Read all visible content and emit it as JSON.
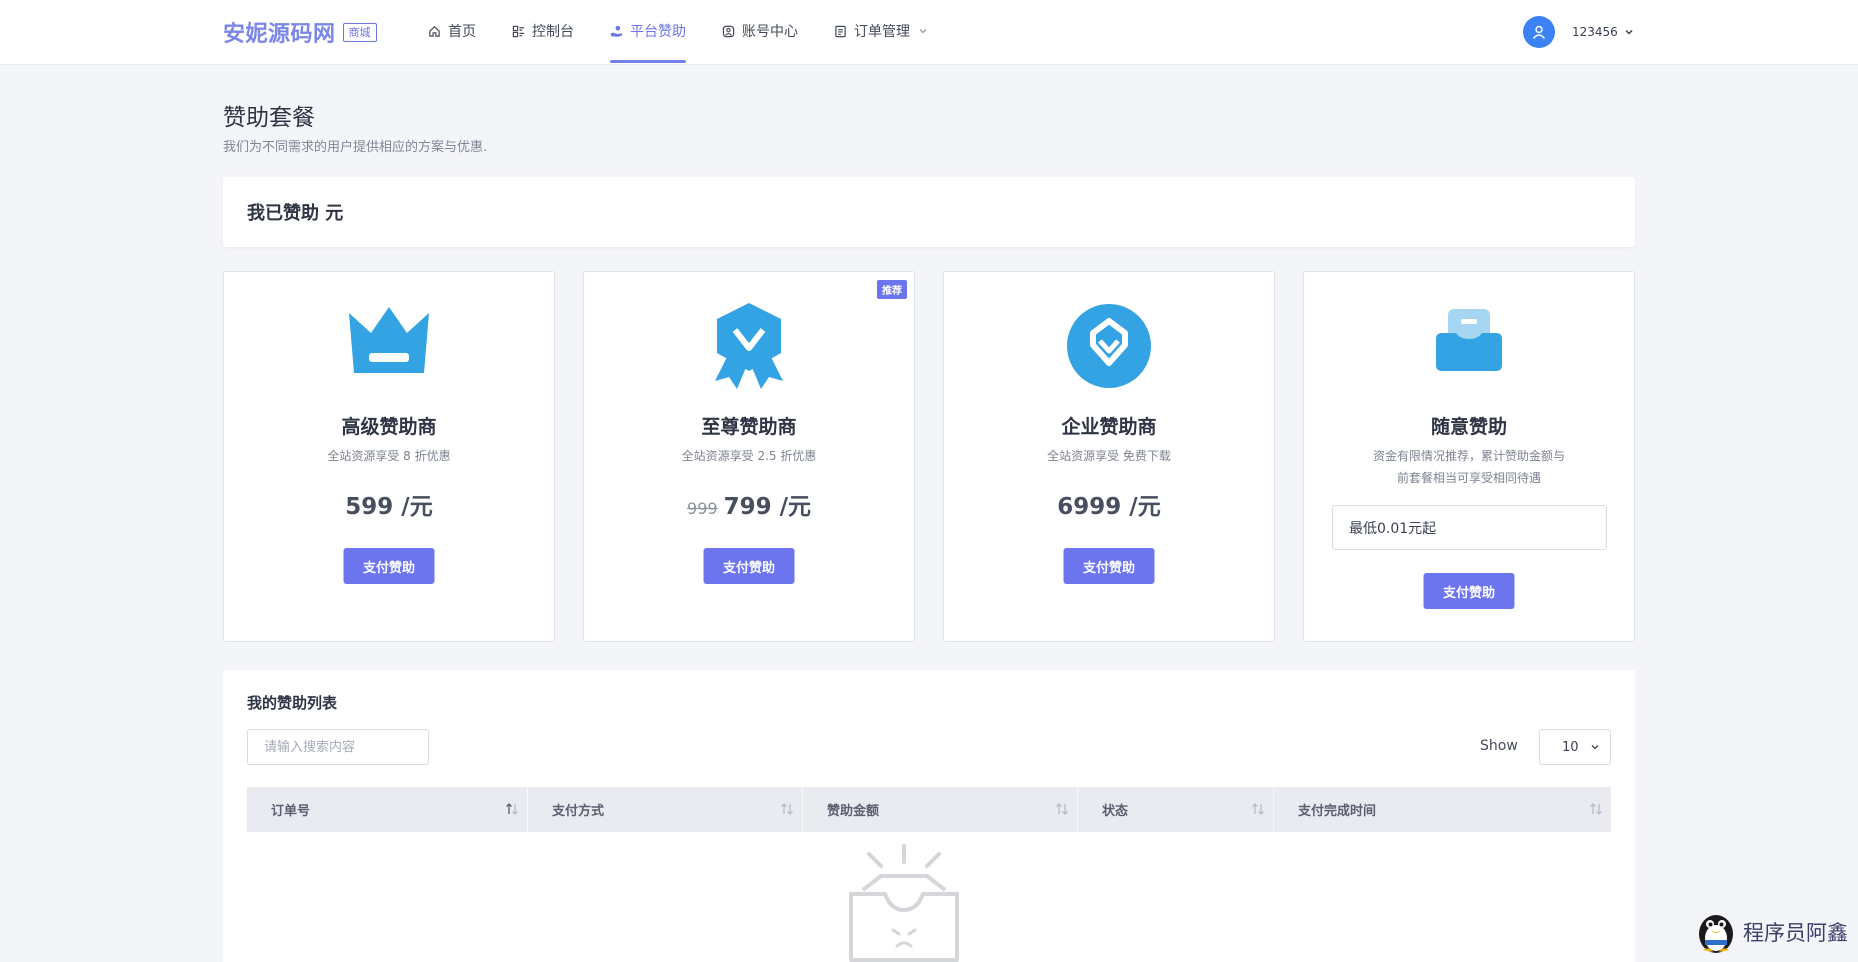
{
  "header": {
    "brand": "安妮源码网",
    "brand_badge": "商城",
    "nav": [
      {
        "label": "首页",
        "icon": "home-icon"
      },
      {
        "label": "控制台",
        "icon": "dashboard-icon"
      },
      {
        "label": "平台赞助",
        "icon": "hand-coin-icon",
        "active": true
      },
      {
        "label": "账号中心",
        "icon": "user-circle-icon"
      },
      {
        "label": "订单管理",
        "icon": "order-icon"
      }
    ],
    "user": {
      "name": "123456",
      "icon": "user-icon"
    }
  },
  "page": {
    "title": "赞助套餐",
    "subtitle": "我们为不同需求的用户提供相应的方案与优惠."
  },
  "sponsored": {
    "text": "我已赞助 元"
  },
  "plans": [
    {
      "name": "高级赞助商",
      "desc": "全站资源享受 8 折优惠",
      "price": "599 /元",
      "old_price": "",
      "button": "支付赞助",
      "icon": "crown-icon"
    },
    {
      "name": "至尊赞助商",
      "desc": "全站资源享受 2.5 折优惠",
      "price": "799 /元",
      "old_price": "999",
      "button": "支付赞助",
      "badge": "推荐",
      "icon": "medal-icon"
    },
    {
      "name": "企业赞助商",
      "desc": "全站资源享受 免费下载",
      "price": "6999 /元",
      "old_price": "",
      "button": "支付赞助",
      "icon": "diamond-icon"
    },
    {
      "name": "随意赞助",
      "desc_line1": "资金有限情况推荐，累计赞助金额与",
      "desc_line2": "前套餐相当可享受相同待遇",
      "input_value": "最低0.01元起",
      "button": "支付赞助",
      "icon": "wallet-icon"
    }
  ],
  "list": {
    "title": "我的赞助列表",
    "search_placeholder": "请输入搜索内容",
    "show_label": "Show",
    "page_size": "10",
    "columns": [
      "订单号",
      "支付方式",
      "赞助金额",
      "状态",
      "支付完成时间"
    ],
    "empty_icon": "empty-box-icon"
  },
  "watermark": {
    "text": "程序员阿鑫",
    "icon": "penguin-icon"
  },
  "colors": {
    "accent": "#6c74ee",
    "icon_blue": "#33a3e3",
    "nav_active": "#6b75e4",
    "background": "#f4f5f9"
  }
}
